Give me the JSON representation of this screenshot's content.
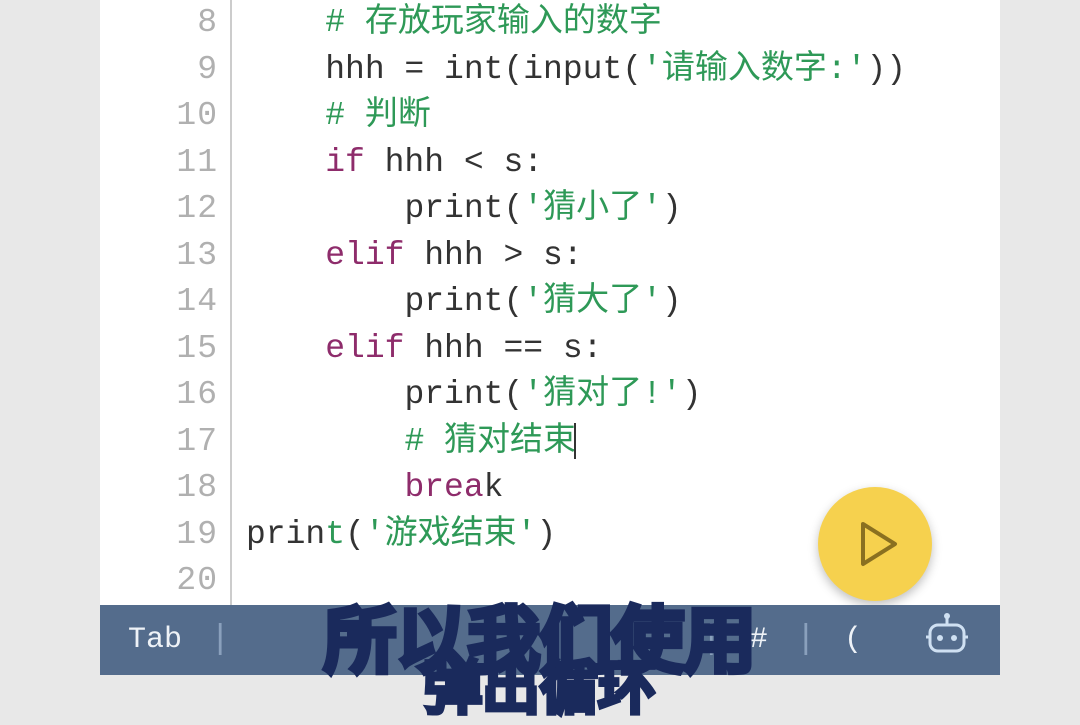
{
  "editor": {
    "lines": [
      {
        "num": "8"
      },
      {
        "num": "9"
      },
      {
        "num": "10"
      },
      {
        "num": "11"
      },
      {
        "num": "12"
      },
      {
        "num": "13"
      },
      {
        "num": "14"
      },
      {
        "num": "15"
      },
      {
        "num": "16"
      },
      {
        "num": "17"
      },
      {
        "num": "18"
      },
      {
        "num": "19"
      },
      {
        "num": "20"
      }
    ],
    "code": {
      "l8_comment": "# 存放玩家输入的数字",
      "l9_prefix": "hhh = int(input(",
      "l9_str": "'请输入数字:'",
      "l9_suffix": "))",
      "l10_comment": "# 判断",
      "l11_kw": "if",
      "l11_rest": " hhh < s:",
      "l12_func": "print(",
      "l12_str": "'猜小了'",
      "l12_close": ")",
      "l13_kw": "elif",
      "l13_rest": " hhh > s:",
      "l14_func": "print(",
      "l14_str": "'猜大了'",
      "l14_close": ")",
      "l15_kw": "elif",
      "l15_rest": " hhh == s:",
      "l16_func": "print(",
      "l16_str": "'猜对了!'",
      "l16_close": ")",
      "l17_comment": "# 猜对结束",
      "l18_kw": "brea",
      "l18_k": "k",
      "l19_func": "prin",
      "l19_t": "t",
      "l19_open": "(",
      "l19_str": "'游戏结束'",
      "l19_close": ")"
    }
  },
  "toolbar": {
    "tab": "Tab",
    "hash": "#",
    "paren": "("
  },
  "subtitle": "所以我们使用",
  "subtitle2": "弹出循环"
}
